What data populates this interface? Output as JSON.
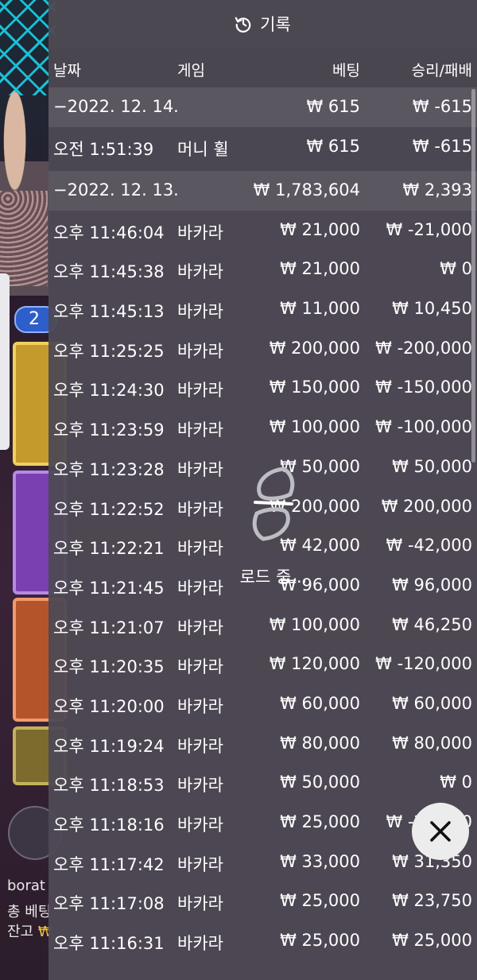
{
  "panel": {
    "title": "기록",
    "columns": {
      "date": "날짜",
      "game": "게임",
      "bet": "베팅",
      "result": "승리/패배"
    },
    "rows": [
      {
        "kind": "day",
        "date": "−2022. 12. 14.",
        "game": "",
        "bet": "₩ 615",
        "result": "₩ -615"
      },
      {
        "kind": "entry",
        "date": "오전 1:51:39",
        "game": "머니 휠",
        "bet": "₩ 615",
        "result": "₩ -615"
      },
      {
        "kind": "day",
        "date": "−2022. 12. 13.",
        "game": "",
        "bet": "₩ 1,783,604",
        "result": "₩ 2,393"
      },
      {
        "kind": "entry",
        "date": "오후 11:46:04",
        "game": "바카라",
        "bet": "₩ 21,000",
        "result": "₩ -21,000"
      },
      {
        "kind": "entry",
        "date": "오후 11:45:38",
        "game": "바카라",
        "bet": "₩ 21,000",
        "result": "₩ 0"
      },
      {
        "kind": "entry",
        "date": "오후 11:45:13",
        "game": "바카라",
        "bet": "₩ 11,000",
        "result": "₩ 10,450"
      },
      {
        "kind": "entry",
        "date": "오후 11:25:25",
        "game": "바카라",
        "bet": "₩ 200,000",
        "result": "₩ -200,000"
      },
      {
        "kind": "entry",
        "date": "오후 11:24:30",
        "game": "바카라",
        "bet": "₩ 150,000",
        "result": "₩ -150,000"
      },
      {
        "kind": "entry",
        "date": "오후 11:23:59",
        "game": "바카라",
        "bet": "₩ 100,000",
        "result": "₩ -100,000"
      },
      {
        "kind": "entry",
        "date": "오후 11:23:28",
        "game": "바카라",
        "bet": "₩ 50,000",
        "result": "₩ 50,000"
      },
      {
        "kind": "entry",
        "date": "오후 11:22:52",
        "game": "바카라",
        "bet": "₩ 200,000",
        "result": "₩ 200,000"
      },
      {
        "kind": "entry",
        "date": "오후 11:22:21",
        "game": "바카라",
        "bet": "₩ 42,000",
        "result": "₩ -42,000"
      },
      {
        "kind": "entry",
        "date": "오후 11:21:45",
        "game": "바카라",
        "bet": "₩ 96,000",
        "result": "₩ 96,000"
      },
      {
        "kind": "entry",
        "date": "오후 11:21:07",
        "game": "바카라",
        "bet": "₩ 100,000",
        "result": "₩ 46,250"
      },
      {
        "kind": "entry",
        "date": "오후 11:20:35",
        "game": "바카라",
        "bet": "₩ 120,000",
        "result": "₩ -120,000"
      },
      {
        "kind": "entry",
        "date": "오후 11:20:00",
        "game": "바카라",
        "bet": "₩ 60,000",
        "result": "₩ 60,000"
      },
      {
        "kind": "entry",
        "date": "오후 11:19:24",
        "game": "바카라",
        "bet": "₩ 80,000",
        "result": "₩ 80,000"
      },
      {
        "kind": "entry",
        "date": "오후 11:18:53",
        "game": "바카라",
        "bet": "₩ 50,000",
        "result": "₩ 0"
      },
      {
        "kind": "entry",
        "date": "오후 11:18:16",
        "game": "바카라",
        "bet": "₩ 25,000",
        "result": "₩ -25,000"
      },
      {
        "kind": "entry",
        "date": "오후 11:17:42",
        "game": "바카라",
        "bet": "₩ 33,000",
        "result": "₩ 31,350"
      },
      {
        "kind": "entry",
        "date": "오후 11:17:08",
        "game": "바카라",
        "bet": "₩ 25,000",
        "result": "₩ 23,750"
      },
      {
        "kind": "entry",
        "date": "오후 11:16:31",
        "game": "바카라",
        "bet": "₩ 25,000",
        "result": "₩ 25,000"
      }
    ],
    "loading_text": "로드 중..."
  },
  "background": {
    "badge_count": "2",
    "chat_user": "borat",
    "total_bet_label": "총 베팅",
    "balance_label": "잔고",
    "balance_currency": "₩"
  },
  "icons": {
    "header": "history-clock-icon",
    "close": "close-icon",
    "loading": "loading-spinner-icon",
    "refresh": "refresh-icon"
  },
  "colors": {
    "panel": "#4e4a54",
    "day_row": "#5b5761",
    "text": "#ffffff",
    "balance_gold": "#f2c23a",
    "badge_blue": "#2e5ec9"
  }
}
